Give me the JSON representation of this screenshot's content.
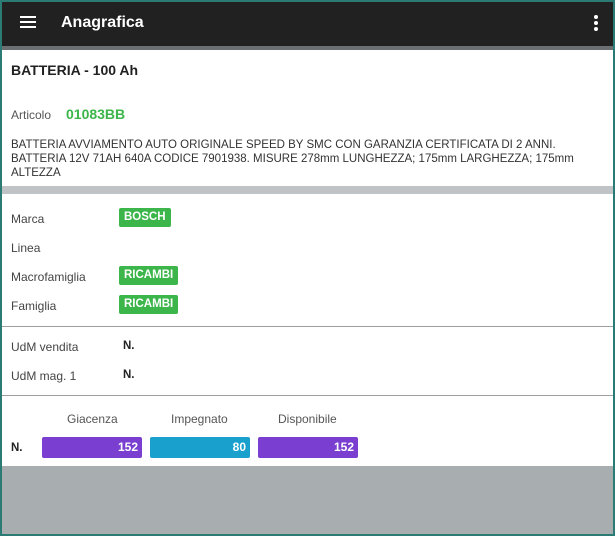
{
  "appbar": {
    "title": "Anagrafica",
    "menu_icon": "hamburger-icon",
    "more_icon": "more-vert-icon"
  },
  "product": {
    "title": "BATTERIA - 100 Ah",
    "article_label": "Articolo",
    "article_code": "01083BB",
    "description": "BATTERIA AVVIAMENTO AUTO ORIGINALE SPEED BY SMC CON GARANZIA CERTIFICATA DI 2 ANNI. BATTERIA 12V 71AH 640A CODICE 7901938. MISURE 278mm LUNGHEZZA; 175mm LARGHEZZA; 175mm ALTEZZA"
  },
  "classification": {
    "brand_label": "Marca",
    "brand": "BOSCH",
    "line_label": "Linea",
    "macro_label": "Macrofamiglia",
    "macro": "RICAMBI",
    "family_label": "Famiglia",
    "family": "RICAMBI"
  },
  "units": {
    "sales_label": "UdM vendita",
    "sales": "N.",
    "store_label": "UdM mag. 1",
    "store": "N."
  },
  "stock": {
    "unit": "N.",
    "headers": [
      "Giacenza",
      "Impegnato",
      "Disponibile"
    ],
    "values": [
      "152",
      "80",
      "152"
    ],
    "colors": [
      "#7a3fd0",
      "#1aa0cc",
      "#7a3fd0"
    ]
  },
  "colors": {
    "accent_green": "#3cb54a",
    "appbar": "#212121"
  }
}
